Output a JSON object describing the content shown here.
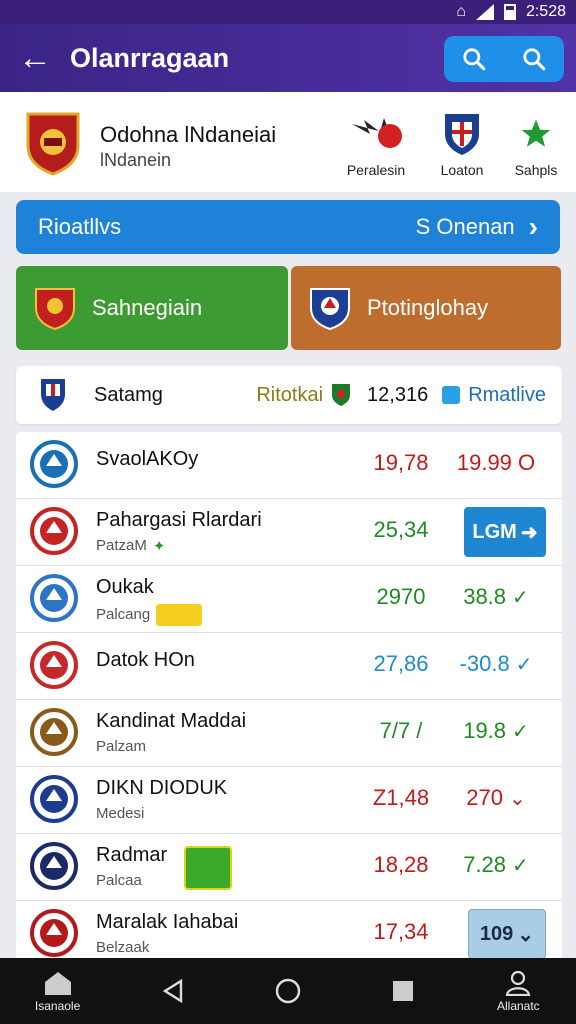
{
  "status": {
    "time": "2:528"
  },
  "appbar": {
    "title": "Olanrragaan",
    "back_icon": "arrow-left-icon",
    "search_icons": [
      "search-icon",
      "search-icon"
    ]
  },
  "league": {
    "name": "Odohna lNdaneiai",
    "subtitle": "lNdanein"
  },
  "quick": [
    {
      "label": "Peralesin",
      "icon": "eagle-icon"
    },
    {
      "label": "Loaton",
      "icon": "shield-icon"
    },
    {
      "label": "Sahpls",
      "icon": "star-icon"
    }
  ],
  "ribbon": {
    "left": "Rioatllvs",
    "right": "S Onenan"
  },
  "buttons": {
    "green": "Sahnegiain",
    "orange": "Ptotinglohay"
  },
  "header": {
    "name": "Satamg",
    "tag": "Ritotkai",
    "number": "12,316",
    "relative": "Rmatlive"
  },
  "rows": [
    {
      "name": "SvaolAKOy",
      "sub": "",
      "v1": "19,78",
      "v2": "19.99 O",
      "v1c": "red",
      "v2c": "red",
      "v2type": "text",
      "logo": "#1b6fb5"
    },
    {
      "name": "Pahargasi Rlardari",
      "sub": "PatzaM",
      "v1": "25,34",
      "v2": "LGM",
      "v1c": "green",
      "v2c": "btn",
      "v2type": "button-blue",
      "logo": "#c62323"
    },
    {
      "name": "Oukak",
      "sub": "Palcang",
      "v1": "2970",
      "v2": "38.8",
      "v1c": "green",
      "v2c": "green",
      "v2type": "check",
      "logo": "#2c75c4"
    },
    {
      "name": "Datok HOn",
      "sub": "",
      "v1": "27,86",
      "v2": "-30.8",
      "v1c": "blue",
      "v2c": "blue",
      "v2type": "check",
      "logo": "#c52a2a"
    },
    {
      "name": "Kandinat Maddai",
      "sub": "Palzam",
      "v1": "7/7 /",
      "v2": "19.8",
      "v1c": "green",
      "v2c": "green",
      "v2type": "check",
      "logo": "#8a5a1b"
    },
    {
      "name": "DIKN DIODUK",
      "sub": "Medesi",
      "v1": "Z1,48",
      "v2": "270",
      "v1c": "red",
      "v2c": "red",
      "v2type": "down",
      "logo": "#1d3c8f"
    },
    {
      "name": "Radmar",
      "sub": "Palcaa",
      "v1": "18,28",
      "v2": "7.28",
      "v1c": "red",
      "v2c": "green",
      "v2type": "check",
      "logo": "#1a2a66"
    },
    {
      "name": "Maralak Iahabai",
      "sub": "Belzaak",
      "v1": "17,34",
      "v2": "109",
      "v1c": "red",
      "v2c": "btn",
      "v2type": "button-gray",
      "logo": "#b21a1a"
    }
  ],
  "nav": {
    "left": "Isanaole",
    "right": "Allanatc"
  }
}
